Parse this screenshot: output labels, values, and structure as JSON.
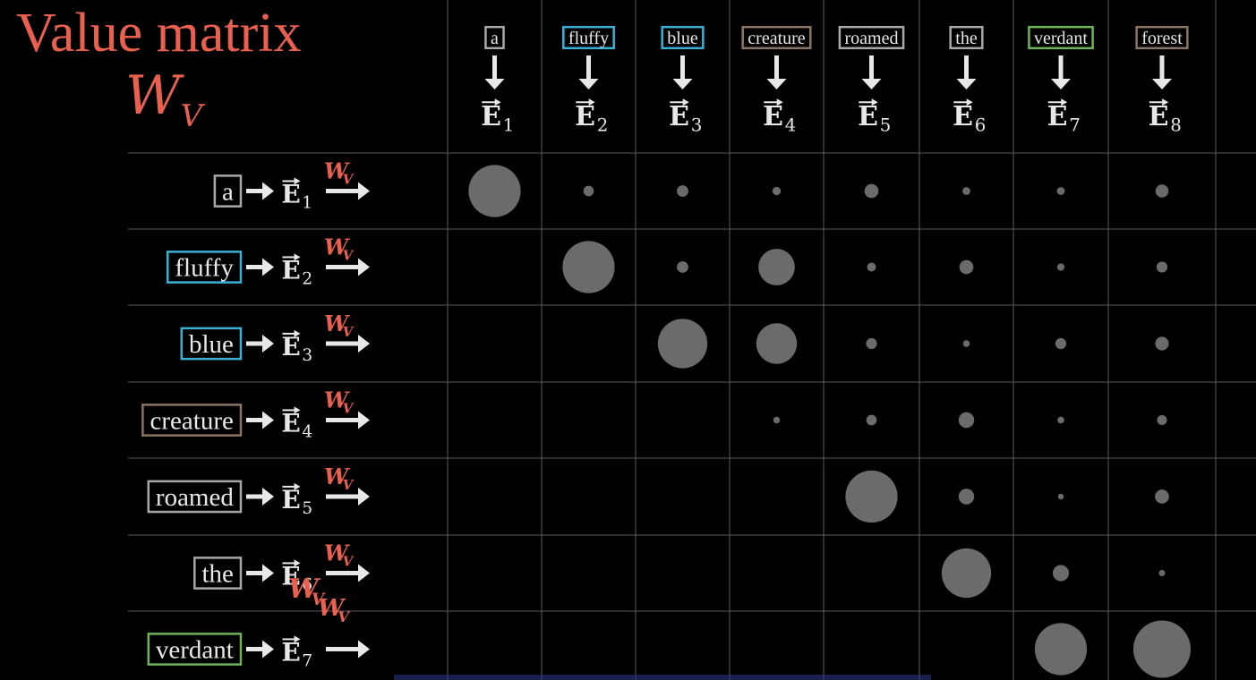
{
  "title": "Value matrix",
  "matrix_symbol": {
    "main": "W",
    "sub": "V"
  },
  "vector_symbol": "E",
  "colors": {
    "background": "#000000",
    "title": "#e9604f",
    "grid": "#5a5a5a",
    "dot": "#6b6b6b",
    "text": "#e8e8e8",
    "arrow": "#e8e8e8",
    "faint_overlay": "#2f3a8a"
  },
  "tokens": [
    {
      "word": "a",
      "color": "#a8a8a8",
      "index": "1"
    },
    {
      "word": "fluffy",
      "color": "#3bb0d6",
      "index": "2"
    },
    {
      "word": "blue",
      "color": "#3bb0d6",
      "index": "3"
    },
    {
      "word": "creature",
      "color": "#8a7565",
      "index": "4"
    },
    {
      "word": "roamed",
      "color": "#a8a8a8",
      "index": "5"
    },
    {
      "word": "the",
      "color": "#a8a8a8",
      "index": "6"
    },
    {
      "word": "verdant",
      "color": "#6fb35a",
      "index": "7"
    },
    {
      "word": "forest",
      "color": "#8a7565",
      "index": "8"
    }
  ],
  "chart_data": {
    "type": "heatmap",
    "encoding": "dot size proportional to weight (upper-triangular)",
    "rows": [
      "a",
      "fluffy",
      "blue",
      "creature",
      "roamed",
      "the",
      "verdant"
    ],
    "columns": [
      "a",
      "fluffy",
      "blue",
      "creature",
      "roamed",
      "the",
      "verdant",
      "forest"
    ],
    "values": [
      [
        1.0,
        0.2,
        0.22,
        0.16,
        0.27,
        0.15,
        0.15,
        0.25
      ],
      [
        null,
        1.0,
        0.22,
        0.7,
        0.17,
        0.27,
        0.14,
        0.21
      ],
      [
        null,
        null,
        0.95,
        0.78,
        0.21,
        0.13,
        0.21,
        0.26
      ],
      [
        null,
        null,
        null,
        0.13,
        0.2,
        0.3,
        0.13,
        0.19
      ],
      [
        null,
        null,
        null,
        null,
        1.0,
        0.3,
        0.11,
        0.27
      ],
      [
        null,
        null,
        null,
        null,
        null,
        0.95,
        0.31,
        0.12
      ],
      [
        null,
        null,
        null,
        null,
        null,
        null,
        1.0,
        1.1
      ]
    ]
  }
}
